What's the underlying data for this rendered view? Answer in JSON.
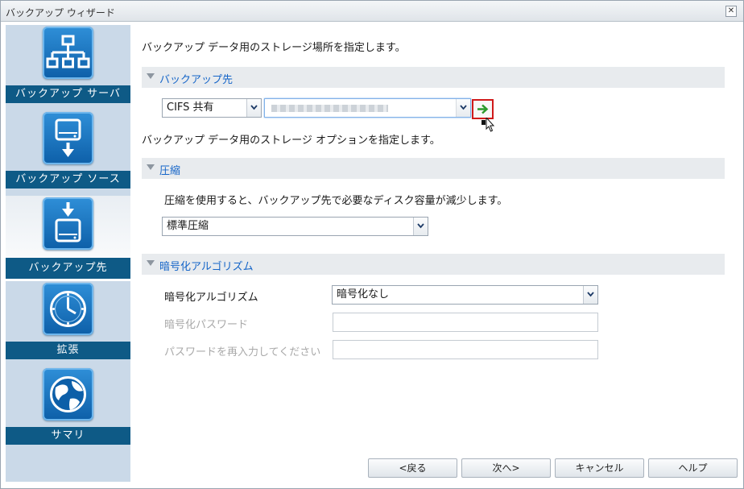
{
  "window": {
    "title": "バックアップ ウィザード",
    "close_glyph": "✕"
  },
  "sidebar": {
    "items": [
      {
        "label": "バックアップ サーバ",
        "icon": "network-server-icon",
        "active": false
      },
      {
        "label": "バックアップ ソース",
        "icon": "drive-export-icon",
        "active": false
      },
      {
        "label": "バックアップ先",
        "icon": "drive-import-icon",
        "active": true
      },
      {
        "label": "拡張",
        "icon": "clock-icon",
        "active": false
      },
      {
        "label": "サマリ",
        "icon": "globe-icon",
        "active": false
      }
    ]
  },
  "main": {
    "intro": "バックアップ データ用のストレージ場所を指定します。",
    "destination": {
      "header": "バックアップ先",
      "type_value": "CIFS 共有",
      "path_value": "",
      "options_text": "バックアップ データ用のストレージ オプションを指定します。"
    },
    "compression": {
      "header": "圧縮",
      "description": "圧縮を使用すると、バックアップ先で必要なディスク容量が減少します。",
      "value": "標準圧縮"
    },
    "encryption": {
      "header": "暗号化アルゴリズム",
      "algorithm_label": "暗号化アルゴリズム",
      "algorithm_value": "暗号化なし",
      "password_label": "暗号化パスワード",
      "password_value": "",
      "confirm_label": "パスワードを再入力してください",
      "confirm_value": ""
    }
  },
  "footer": {
    "back": "<戻る",
    "next": "次へ>",
    "cancel": "キャンセル",
    "help": "ヘルプ"
  },
  "colors": {
    "accent": "#1565c8",
    "sidebar_bg": "#cad9e8",
    "nav_label_bg": "#0e5a86",
    "highlight_border": "#d01a1a"
  }
}
